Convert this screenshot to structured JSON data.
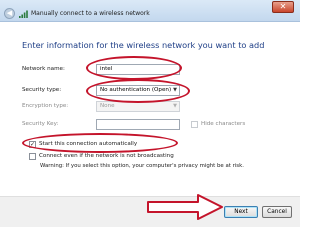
{
  "window": {
    "title": "Manually connect to a wireless network",
    "close_glyph": "✕",
    "back_glyph": "◀",
    "icons": [
      "back-arrow-icon",
      "wifi-icon",
      "close-icon"
    ]
  },
  "heading": "Enter information for the wireless network you want to add",
  "form": {
    "network_name_label": "Network name:",
    "network_name_value": "intel",
    "security_type_label": "Security type:",
    "security_type_value": "No authentication (Open)",
    "encryption_type_label": "Encryption type:",
    "encryption_type_value": "None",
    "security_key_label": "Security Key:",
    "security_key_value": "",
    "hide_characters_label": "Hide characters",
    "hide_characters_checked": false,
    "start_auto_label": "Start this connection automatically",
    "start_auto_checked": true,
    "connect_even_label": "Connect even if the network is not broadcasting",
    "connect_even_checked": false,
    "warning": "Warning: If you select this option, your computer's privacy might be at risk.",
    "dropdown_glyph": "▼",
    "check_glyph": "✓"
  },
  "buttons": {
    "next": "Next",
    "cancel": "Cancel"
  },
  "colors": {
    "heading": "#1f3f87",
    "annotation": "#c4142b",
    "titlebar": "#c3d8ee"
  }
}
